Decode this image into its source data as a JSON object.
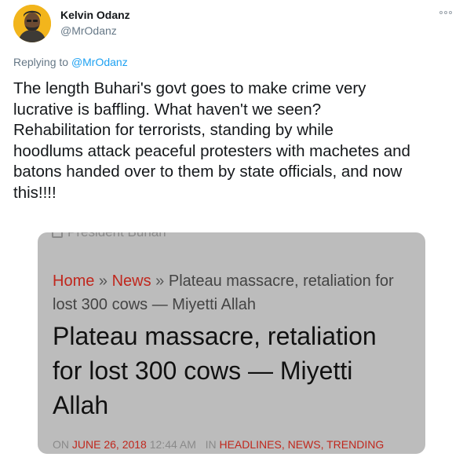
{
  "author": {
    "name": "Kelvin Odanz",
    "handle": "@MrOdanz"
  },
  "replying": {
    "prefix": "Replying to",
    "handle": "@MrOdanz"
  },
  "tweet": {
    "lines": [
      "The length Buhari's govt goes to make crime very",
      "lucrative is baffling. What haven't we seen?",
      "Rehabilitation for terrorists, standing by while",
      "hoodlums attack peaceful protesters with machetes and",
      "batons handed over to them by state officials, and now",
      "this!!!!"
    ]
  },
  "card": {
    "top_partial": "President Buhari",
    "breadcrumb": {
      "home": "Home",
      "sep1": " » ",
      "news": "News",
      "sep2": " » ",
      "current": "Plateau massacre, retaliation for lost 300 cows — Miyetti Allah"
    },
    "headline_lines": [
      "Plateau massacre, retaliation",
      "for lost 300 cows — Miyetti",
      "Allah"
    ],
    "meta": {
      "on": "ON",
      "date": "JUNE 26, 2018",
      "time": "12:44 AM",
      "in": "IN",
      "cat1": "HEADLINES",
      "cat2": "NEWS",
      "cat3": "TRENDING"
    }
  },
  "colors": {
    "link_blue": "#1da1f2",
    "site_red": "#c0271d",
    "card_gray": "#bcbcbc"
  }
}
